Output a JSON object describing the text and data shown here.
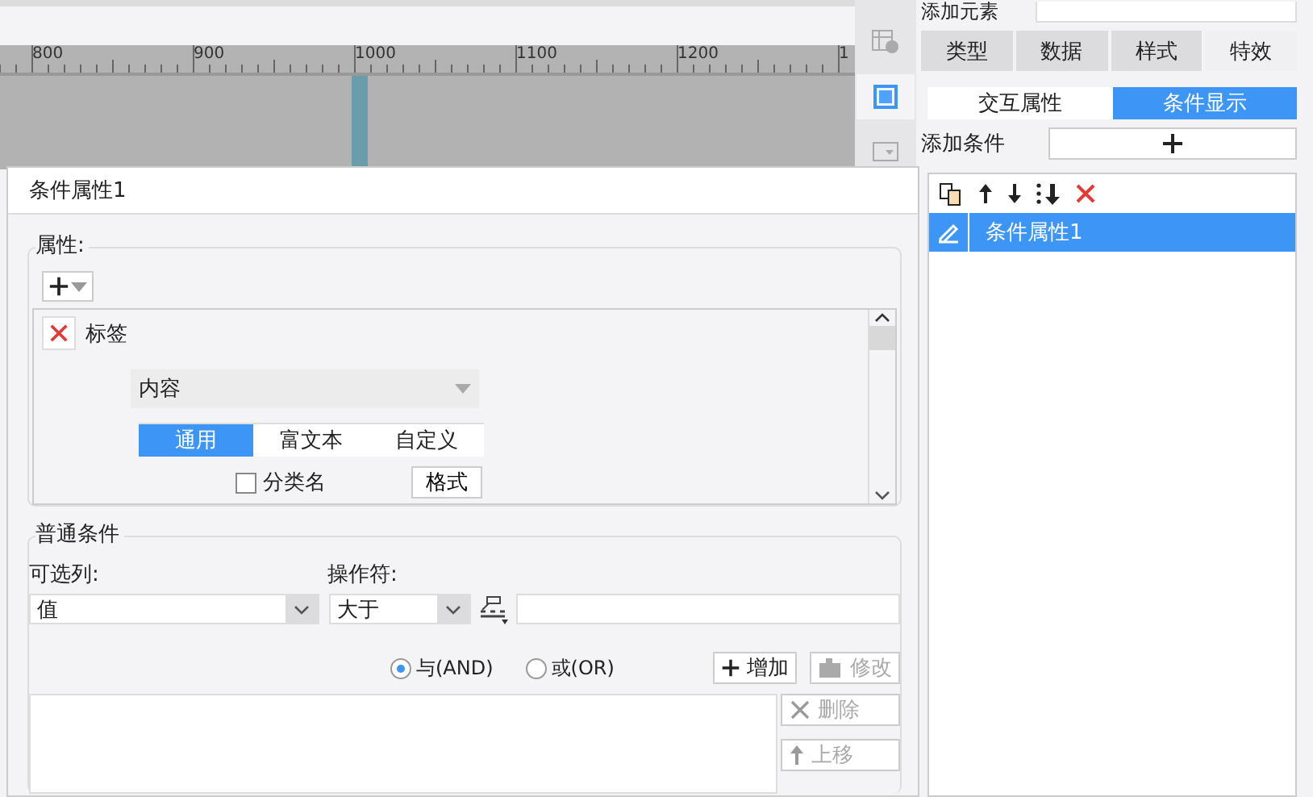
{
  "canvas": {
    "ruler_labels": [
      "800",
      "900",
      "1000",
      "1100",
      "1200",
      "1"
    ]
  },
  "side_tools": [
    {
      "kind": "grid-info",
      "selected": false
    },
    {
      "kind": "frame",
      "selected": true
    },
    {
      "kind": "dropdown",
      "selected": false
    }
  ],
  "panel": {
    "add_element_label": "添加元素",
    "tabs": [
      {
        "label": "类型",
        "selected": false
      },
      {
        "label": "数据",
        "selected": false
      },
      {
        "label": "样式",
        "selected": false
      },
      {
        "label": "特效",
        "selected": true
      }
    ],
    "subtabs": [
      {
        "label": "交互属性",
        "selected": false
      },
      {
        "label": "条件显示",
        "selected": true
      }
    ],
    "add_condition_label": "添加条件",
    "toolbar": [
      {
        "kind": "copy"
      },
      {
        "kind": "up"
      },
      {
        "kind": "down"
      },
      {
        "kind": "bottom"
      },
      {
        "kind": "delete"
      }
    ],
    "conditions": [
      {
        "label": "条件属性1",
        "selected": true
      }
    ]
  },
  "dialog": {
    "title": "条件属性1",
    "attributes_legend": "属性:",
    "attribute": {
      "name": "标签",
      "content_select": "内容",
      "format_tabs": [
        {
          "label": "通用",
          "selected": true
        },
        {
          "label": "富文本",
          "selected": false
        },
        {
          "label": "自定义",
          "selected": false
        }
      ],
      "category_checkbox": {
        "label": "分类名",
        "checked": false
      },
      "format_button": "格式"
    },
    "general_legend": "普通条件",
    "column_label": "可选列:",
    "column_value": "值",
    "operator_label": "操作符:",
    "operator_value": "大于",
    "logic": [
      {
        "label": "与(AND)",
        "selected": true
      },
      {
        "label": "或(OR)",
        "selected": false
      }
    ],
    "add_button": "增加",
    "edit_button": {
      "label": "修改",
      "disabled": true
    },
    "side_buttons": [
      {
        "kind": "delete",
        "label": "删除",
        "disabled": true
      },
      {
        "kind": "up",
        "label": "上移",
        "disabled": true
      }
    ]
  }
}
